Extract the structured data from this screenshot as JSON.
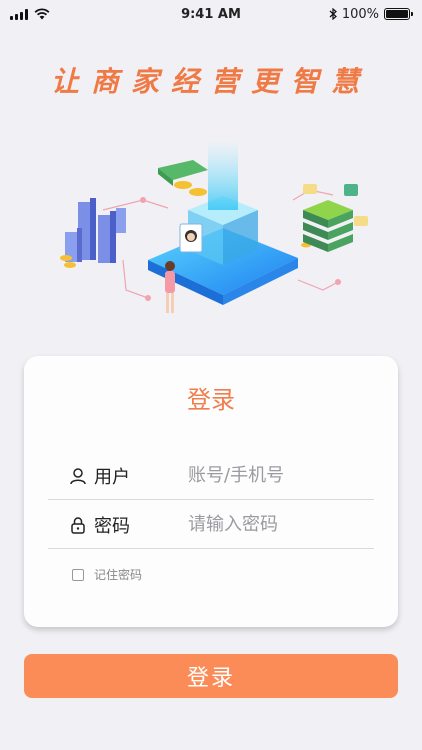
{
  "status_bar": {
    "time": "9:41 AM",
    "battery": "100%",
    "battery_level": 1.0
  },
  "slogan": "让商家经营更智慧",
  "login_card": {
    "title": "登录",
    "username": {
      "label": "用户",
      "placeholder": "账号/手机号",
      "value": ""
    },
    "password": {
      "label": "密码",
      "placeholder": "请输入密码",
      "value": ""
    },
    "remember_label": "记住密码",
    "remember_checked": false
  },
  "submit_label": "登录",
  "colors": {
    "accent": "#fb8c57",
    "title": "#ef7e4c",
    "background": "#f1f0f5"
  },
  "icons": [
    "wifi-icon",
    "signal-icon",
    "bluetooth-icon",
    "battery-icon",
    "user-icon",
    "lock-icon",
    "checkbox-icon"
  ]
}
